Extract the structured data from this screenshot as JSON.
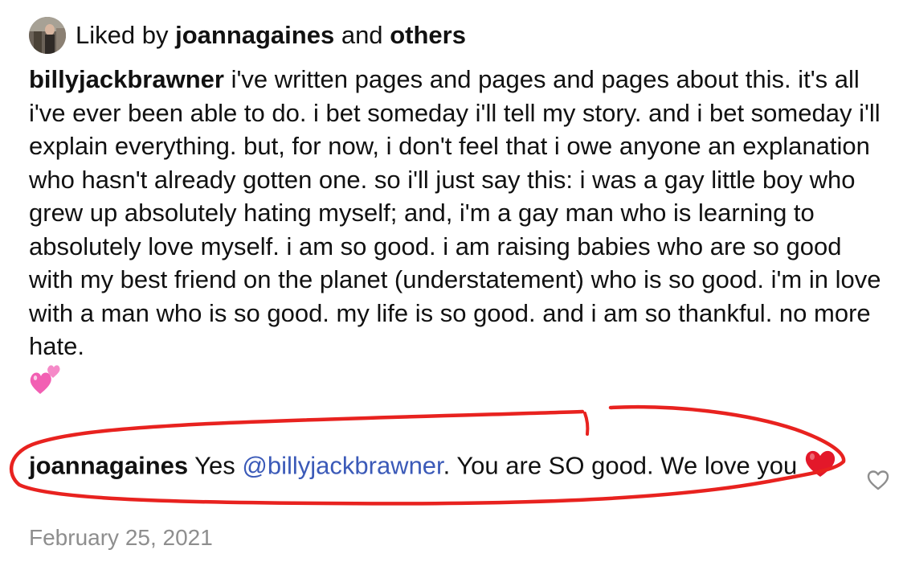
{
  "liked": {
    "prefix": "Liked by",
    "user": "joannagaines",
    "joiner": "and",
    "others": "others"
  },
  "caption": {
    "username": "billyjackbrawner",
    "text": "i've written pages and pages and pages about this. it's all i've ever been able to do. i bet someday i'll tell my story. and i bet someday i'll explain everything. but, for now, i don't feel that i owe anyone an explanation who hasn't already gotten one. so i'll just say this: i was a gay little boy who grew up absolutely hating myself; and, i'm a gay man who is learning to absolutely love myself. i am so good. i am raising babies who are so good with my best friend on the planet (understatement) who is so good. i'm in love with a man who is so good. my life is so good. and i am so thankful. no more hate.",
    "emoji": "two-hearts-emoji"
  },
  "reply": {
    "username": "joannagaines",
    "pre": "Yes",
    "mention": "@billyjackbrawner",
    "post": ". You are SO good. We love you",
    "emoji": "red-heart-emoji"
  },
  "date": "February 25, 2021",
  "colors": {
    "mention": "#3b5ab8",
    "date": "#8e8e8e",
    "annotation": "#e8221f",
    "heart": "#e3182a",
    "pink_hearts": "#f25fb3"
  },
  "icons": {
    "like": "heart-outline-icon"
  }
}
